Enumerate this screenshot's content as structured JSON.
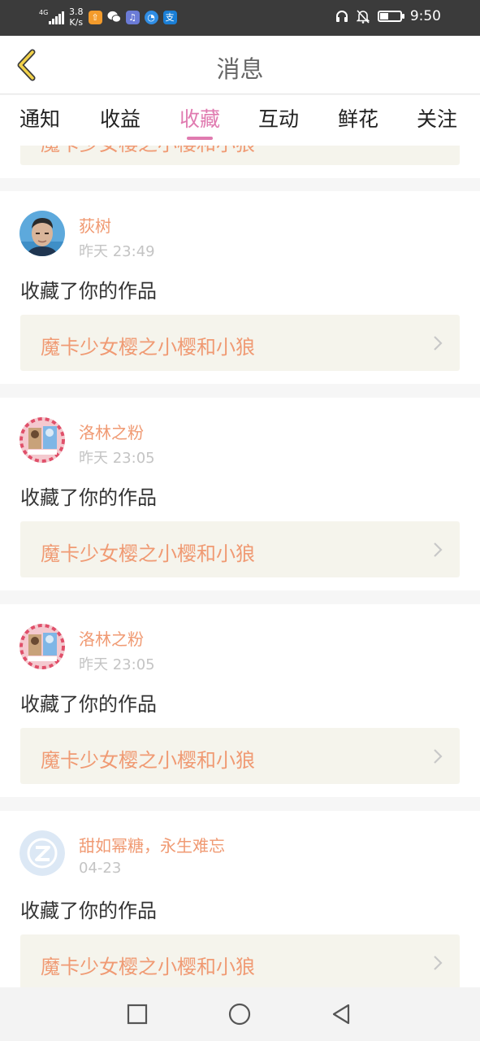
{
  "status_bar": {
    "network": "4G",
    "speed_value": "3.8",
    "speed_unit": "K/s",
    "notif_icons": [
      "orange-app-icon",
      "wechat-icon",
      "music-app-icon",
      "browser-icon",
      "alipay-icon"
    ],
    "right_icons": [
      "headphones-icon",
      "mute-bell-icon",
      "battery-icon"
    ],
    "time": "9:50"
  },
  "header": {
    "back_icon": "chevron-left-icon",
    "title": "消息"
  },
  "tabs": [
    {
      "label": "通知"
    },
    {
      "label": "收益"
    },
    {
      "label": "收藏",
      "active": true
    },
    {
      "label": "互动"
    },
    {
      "label": "鲜花"
    },
    {
      "label": "关注"
    }
  ],
  "partial_item": {
    "work_title": "魔卡少女樱之小樱和小狼"
  },
  "messages": [
    {
      "user": "荻树",
      "time": "昨天 23:49",
      "action": "收藏了你的作品",
      "work_title": "魔卡少女樱之小樱和小狼",
      "avatar": "photo-avatar"
    },
    {
      "user": "洛林之粉",
      "time": "昨天 23:05",
      "action": "收藏了你的作品",
      "work_title": "魔卡少女樱之小樱和小狼",
      "avatar": "anime-avatar"
    },
    {
      "user": "洛林之粉",
      "time": "昨天 23:05",
      "action": "收藏了你的作品",
      "work_title": "魔卡少女樱之小樱和小狼",
      "avatar": "anime-avatar"
    },
    {
      "user": "甜如幂糖，永生难忘",
      "time": "04-23",
      "action": "收藏了你的作品",
      "work_title": "魔卡少女樱之小樱和小狼",
      "avatar": "default-avatar"
    }
  ],
  "colors": {
    "accent": "#e07bb0",
    "name": "#f09a73",
    "work_bg": "#f5f4ec"
  }
}
